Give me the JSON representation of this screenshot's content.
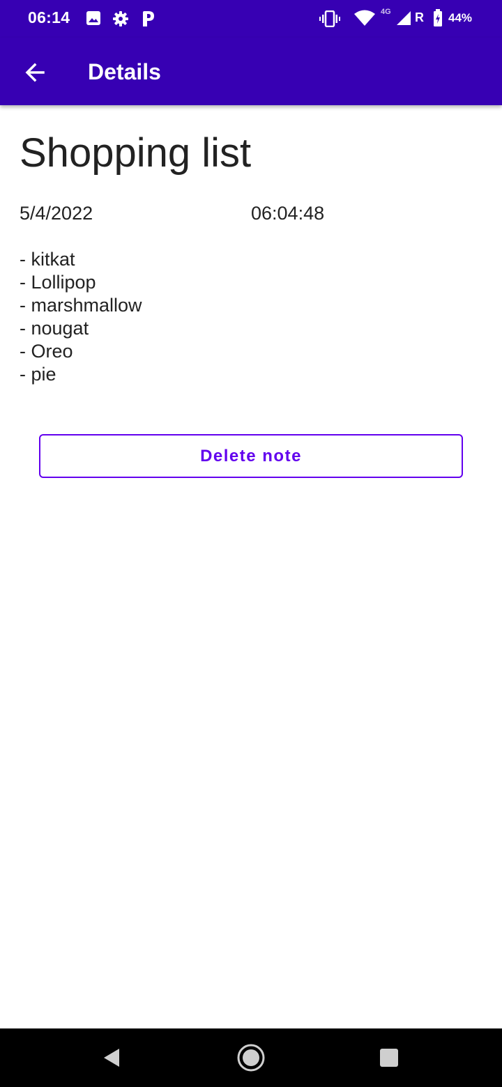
{
  "status_bar": {
    "time": "06:14",
    "network": "4G",
    "roaming": "R",
    "battery": "44%",
    "icons": [
      "image-icon",
      "gear-icon",
      "p-icon",
      "vibrate-icon",
      "wifi-icon",
      "signal-icon",
      "battery-icon"
    ]
  },
  "app_bar": {
    "title": "Details",
    "back_icon": "arrow-left-icon",
    "color": "#3700b3"
  },
  "note": {
    "title": "Shopping list",
    "date": "5/4/2022",
    "time": "06:04:48",
    "lines": [
      "- kitkat",
      "- Lollipop",
      "- marshmallow",
      "- nougat",
      "- Oreo",
      "- pie"
    ]
  },
  "actions": {
    "delete_label": "Delete note",
    "accent": "#6200ee"
  },
  "nav_bar": {
    "icons": [
      "back-triangle-icon",
      "home-circle-icon",
      "recents-square-icon"
    ]
  }
}
